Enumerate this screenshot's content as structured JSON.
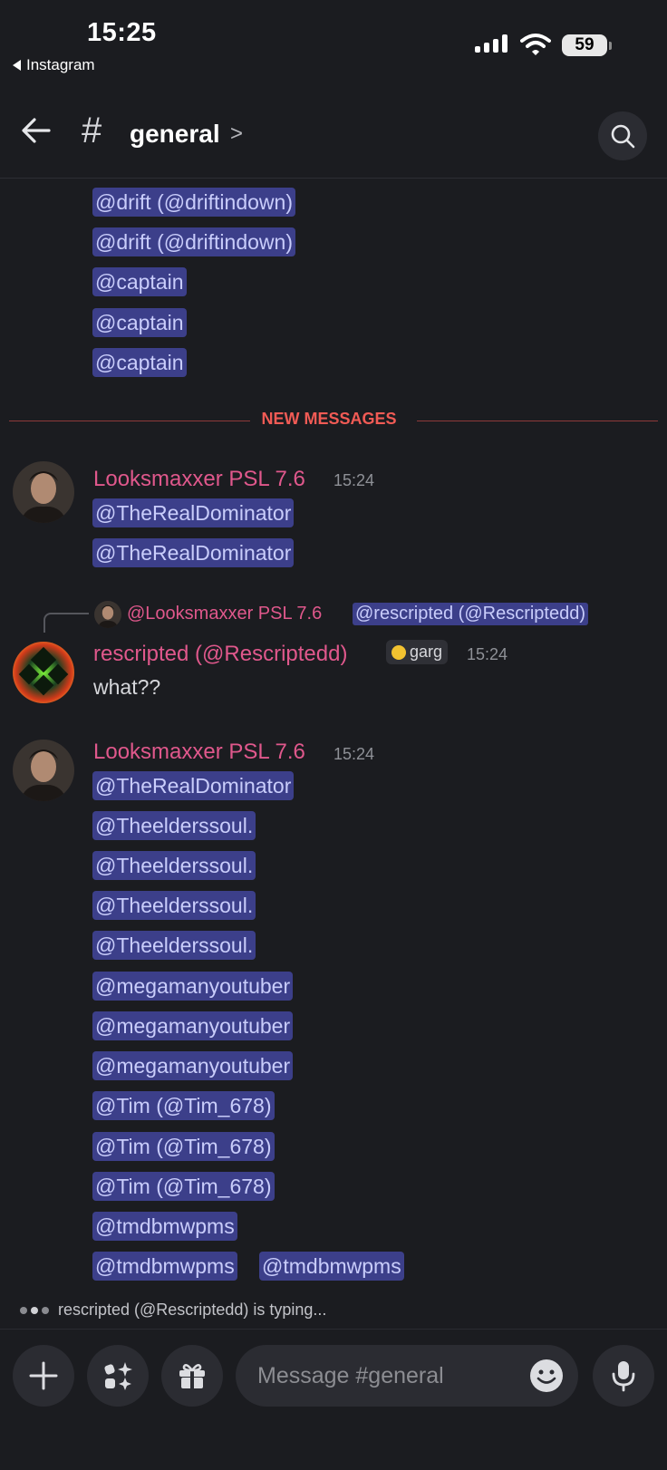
{
  "status_bar": {
    "time": "15:25",
    "back_app": "Instagram",
    "battery": "59"
  },
  "header": {
    "hash": "#",
    "channel": "general",
    "chevron": ">"
  },
  "top_mentions": [
    "@drift (@driftindown)",
    "@drift (@driftindown)",
    "@captain",
    "@captain",
    "@captain"
  ],
  "new_messages_label": "NEW MESSAGES",
  "messages": [
    {
      "username": "Looksmaxxer PSL 7.6",
      "time": "15:24",
      "mentions": [
        "@TheRealDominator",
        "@TheRealDominator"
      ]
    },
    {
      "reply": {
        "user": "@Looksmaxxer PSL 7.6",
        "mention": "@rescripted (@Rescriptedd)"
      },
      "username": "rescripted (@Rescriptedd)",
      "tag": "garg",
      "time": "15:24",
      "text": "what??"
    },
    {
      "username": "Looksmaxxer PSL 7.6",
      "time": "15:24",
      "mentions": [
        "@TheRealDominator",
        "@Theelderssoul.",
        "@Theelderssoul.",
        "@Theelderssoul.",
        "@Theelderssoul.",
        "@megamanyoutuber",
        "@megamanyoutuber",
        "@megamanyoutuber",
        "@Tim (@Tim_678)",
        "@Tim (@Tim_678)",
        "@Tim (@Tim_678)",
        "@tmdbmwpms",
        "@tmdbmwpms",
        "@tmdbmwpms"
      ]
    }
  ],
  "typing": "rescripted (@Rescriptedd) is typing...",
  "composer": {
    "placeholder": "Message #general"
  },
  "colors": {
    "background": "#1b1c20",
    "mention_bg": "#3c3f8a",
    "mention_text": "#c9cdfb",
    "username": "#e0588c",
    "new_messages": "#f15b55"
  },
  "icons": [
    "back-arrow-icon",
    "search-icon",
    "plus-icon",
    "apps-icon",
    "gift-icon",
    "emoji-icon",
    "microphone-icon"
  ]
}
